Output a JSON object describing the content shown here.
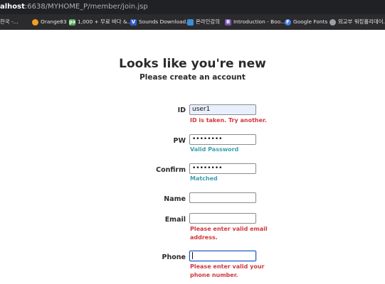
{
  "browser": {
    "url_host": "alhost",
    "url_rest": ":6638/MYHOME_P/member/join.jsp",
    "bookmarks": [
      {
        "label": "한국 -...",
        "icon": "page-icon",
        "color": "#5f6368"
      },
      {
        "label": "Orange83",
        "icon": "orange-circle-icon",
        "color": "#f0a020"
      },
      {
        "label": "1,000 + 무료 바다 &...",
        "icon": "px-logo-icon",
        "color": "#4caf50"
      },
      {
        "label": "Sounds Download...",
        "icon": "v-logo-icon",
        "color": "#2d5fd2"
      },
      {
        "label": "온라인강의",
        "icon": "lecture-icon",
        "color": "#3b8ed8"
      },
      {
        "label": "Introduction - Boo...",
        "icon": "bootstrap-icon",
        "color": "#7952b3"
      },
      {
        "label": "Google Fonts",
        "icon": "google-fonts-icon",
        "color": "#4a7df0"
      },
      {
        "label": "외교부 워킹홀리데이...",
        "icon": "globe-icon",
        "color": "#9aa0a6"
      }
    ]
  },
  "page": {
    "title": "Looks like you're new",
    "subtitle": "Please create an account"
  },
  "form": {
    "id": {
      "label": "ID",
      "value": "user1",
      "message": "ID is taken. Try another."
    },
    "pw": {
      "label": "PW",
      "value": "••••••••",
      "message": "Valid Password"
    },
    "confirm": {
      "label": "Confirm",
      "value": "••••••••",
      "message": "Matched"
    },
    "name": {
      "label": "Name",
      "value": ""
    },
    "email": {
      "label": "Email",
      "value": "",
      "message_line1": "Please enter valid email",
      "message_line2": "address."
    },
    "phone": {
      "label": "Phone",
      "value": "",
      "message_line1": "Please enter valid your",
      "message_line2": "phone number."
    }
  },
  "colors": {
    "error": "#d0373b",
    "success": "#3a9fb0",
    "focus_border": "#1a56c4"
  }
}
